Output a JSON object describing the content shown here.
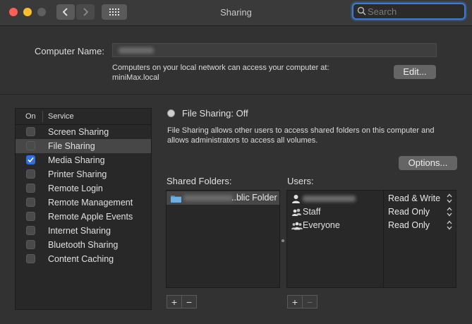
{
  "window": {
    "title": "Sharing"
  },
  "search": {
    "placeholder": "Search"
  },
  "computer_name": {
    "label": "Computer Name:",
    "info_line1": "Computers on your local network can access your computer at:",
    "info_line2": "miniMax.local",
    "edit_label": "Edit..."
  },
  "services": {
    "col_on": "On",
    "col_service": "Service",
    "items": [
      {
        "label": "Screen Sharing",
        "checked": false
      },
      {
        "label": "File Sharing",
        "checked": false,
        "selected": true
      },
      {
        "label": "Media Sharing",
        "checked": true
      },
      {
        "label": "Printer Sharing",
        "checked": false
      },
      {
        "label": "Remote Login",
        "checked": false
      },
      {
        "label": "Remote Management",
        "checked": false
      },
      {
        "label": "Remote Apple Events",
        "checked": false
      },
      {
        "label": "Internet Sharing",
        "checked": false
      },
      {
        "label": "Bluetooth Sharing",
        "checked": false
      },
      {
        "label": "Content Caching",
        "checked": false
      }
    ]
  },
  "file_sharing": {
    "status": "File Sharing: Off",
    "desc_line1": "File Sharing allows other users to access shared folders on this computer and",
    "desc_line2": "allows administrators to access all volumes.",
    "options_label": "Options..."
  },
  "shared_folders": {
    "label": "Shared Folders:",
    "items": [
      {
        "visible_suffix": "..blic Folder"
      }
    ]
  },
  "users": {
    "label": "Users:",
    "items": [
      {
        "name": "",
        "permission": "Read & Write",
        "icon": "person-icon"
      },
      {
        "name": "Staff",
        "permission": "Read Only",
        "icon": "group-icon"
      },
      {
        "name": "Everyone",
        "permission": "Read Only",
        "icon": "everyone-icon"
      }
    ]
  },
  "controls": {
    "add": "+",
    "remove": "−"
  },
  "colors": {
    "accent": "#2f6fde",
    "focus_ring": "#3a7bd5"
  }
}
